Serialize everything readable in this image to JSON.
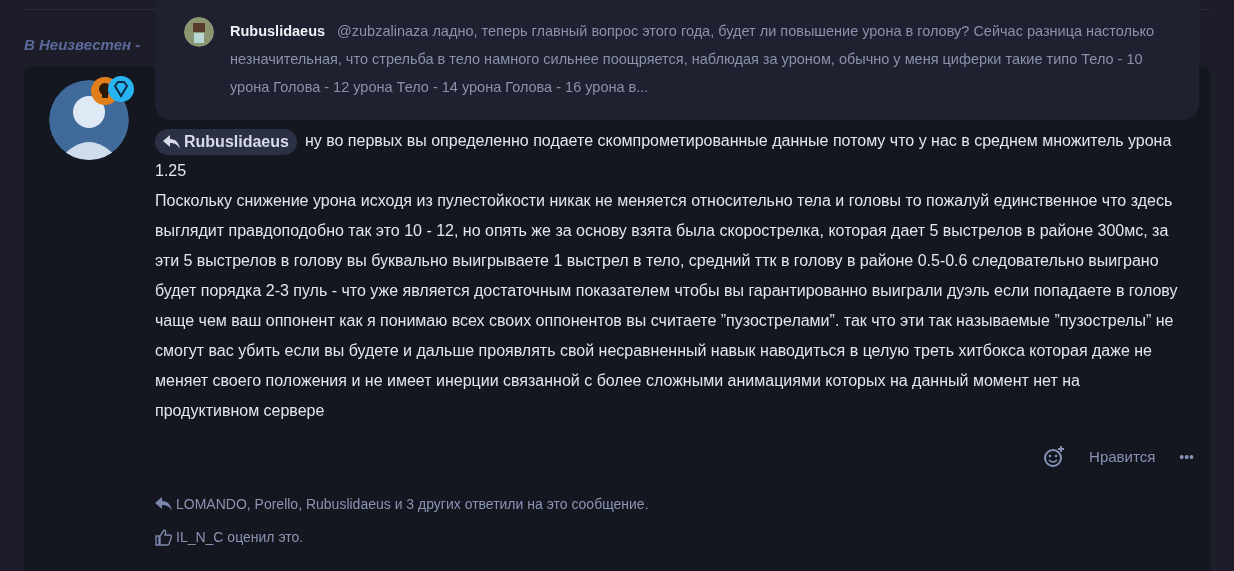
{
  "breadcrumb": "В Неизвестен -",
  "quote_popup": {
    "author": "Rubuslidaeus",
    "text": "@zubzalinaza ладно, теперь главный вопрос этого года, будет ли повышение урона в голову? Сейчас разница настолько незначительная, что стрельба в тело намного сильнее поощряется, наблюдая за уроном, обычно у меня циферки такие типо Тело - 10 урона Голова - 12 урона Тело - 14 урона Голова - 16 урона в..."
  },
  "post": {
    "reply_to": "Rubuslidaeus",
    "paragraphs": [
      "ну во первых вы определенно подаете скомпрометированные данные потому что у нас в среднем множитель урона 1.25",
      "Поскольку снижение урона исходя из пулестойкости никак не меняется относительно тела и головы то пожалуй единственное что здесь выглядит правдоподобно так это 10 - 12, но опять же за основу взята была скорострелка, которая дает 5 выстрелов в районе 300мс, за эти 5 выстрелов в голову вы буквально выигрываете 1 выстрел в тело, средний ттк в голову в районе 0.5-0.6 следовательно выиграно будет порядка 2-3 пуль - что уже является достаточным показателем чтобы вы гарантированно выиграли дуэль если попадаете в голову чаще чем ваш оппонент как я понимаю всех своих оппонентов вы считаете ”пузострелами”. так что эти так называемые ”пузострелы” не смогут вас убить если вы будете и дальше проявлять свой несравненный навык наводиться в целую треть хитбокса которая даже не меняет своего положения и не имеет инерции связанной с более сложными анимациями которых на данный момент нет на продуктивном сервере"
    ],
    "like_label": "Нравится",
    "more": "•••",
    "replies": "LOMANDO, Porello, Rubuslidaeus и 3 других ответили на это сообщение.",
    "likes": "IL_N_C оценил это."
  }
}
